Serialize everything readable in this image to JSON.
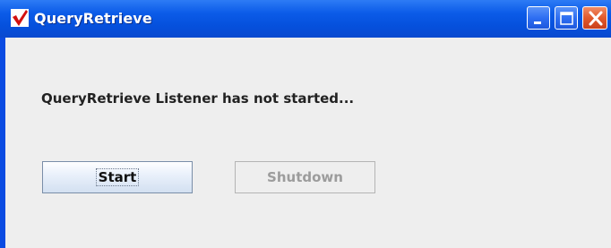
{
  "window": {
    "title": "QueryRetrieve",
    "controls": [
      "minimize",
      "maximize",
      "close"
    ]
  },
  "main": {
    "status_text": "QueryRetrieve Listener has not started...",
    "start_label": "Start",
    "shutdown_label": "Shutdown"
  },
  "colors": {
    "titlebar": "#0b5be8",
    "client_bg": "#eeeeee",
    "disabled_text": "#9c9c9c",
    "close_button": "#e25a2c"
  },
  "icons": {
    "app": "app-logo-icon",
    "minimize": "minimize-icon",
    "maximize": "maximize-icon",
    "close": "close-icon"
  }
}
